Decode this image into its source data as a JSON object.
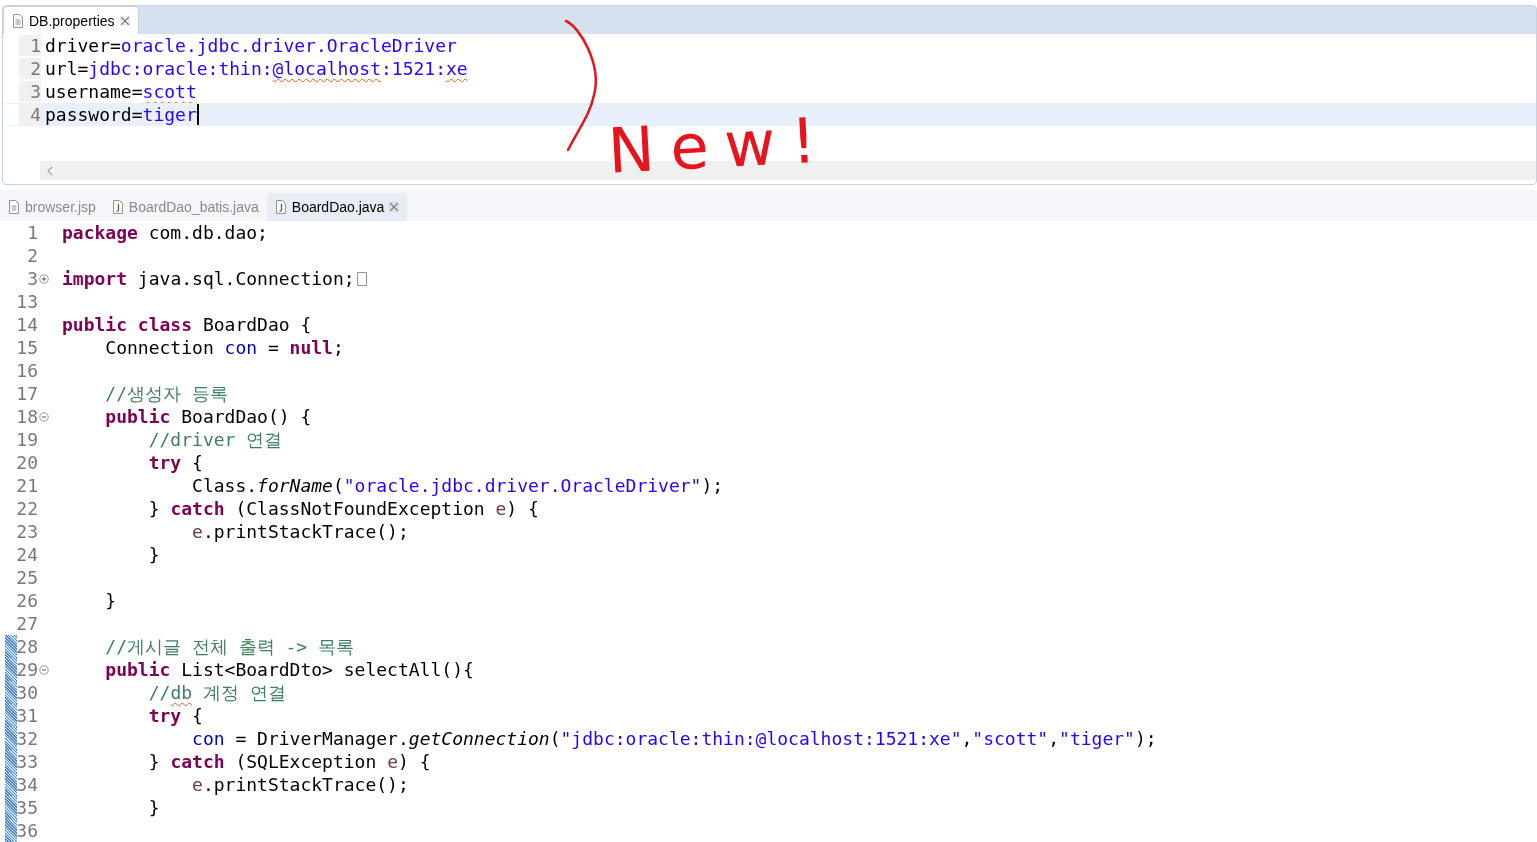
{
  "properties_editor": {
    "tabs": [
      {
        "label": "DB.properties",
        "kind": "text-file",
        "selected": true,
        "closable": true
      }
    ],
    "lines": [
      {
        "number": "1",
        "current": false,
        "caret": false,
        "tokens": [
          {
            "kind": "key",
            "text": "driver="
          },
          {
            "kind": "value",
            "text": "oracle.jdbc.driver.OracleDriver"
          }
        ]
      },
      {
        "number": "2",
        "current": false,
        "caret": false,
        "tokens": [
          {
            "kind": "key",
            "text": "url="
          },
          {
            "kind": "value",
            "text": "jdbc:oracle:thin:"
          },
          {
            "kind": "value",
            "text": "@localhost",
            "squiggle": true
          },
          {
            "kind": "value",
            "text": ":1521:"
          },
          {
            "kind": "value",
            "text": "xe",
            "squiggle": true
          }
        ]
      },
      {
        "number": "3",
        "current": false,
        "caret": false,
        "tokens": [
          {
            "kind": "key",
            "text": "username="
          },
          {
            "kind": "value",
            "text": "scott",
            "squiggle": true
          }
        ]
      },
      {
        "number": "4",
        "current": true,
        "caret": true,
        "tokens": [
          {
            "kind": "key",
            "text": "password="
          },
          {
            "kind": "value",
            "text": "tiger"
          }
        ]
      }
    ]
  },
  "java_editor": {
    "tabs": [
      {
        "label": "browser.jsp",
        "kind": "text-file",
        "selected": false,
        "closable": false
      },
      {
        "label": "BoardDao_batis.java",
        "kind": "java-file",
        "selected": false,
        "closable": false
      },
      {
        "label": "BoardDao.java",
        "kind": "java-file",
        "selected": true,
        "closable": true
      }
    ],
    "lines": [
      {
        "number": "1",
        "kind": "line",
        "changed": false,
        "tokens": [
          {
            "kind": "keyword",
            "text": "package"
          },
          {
            "kind": "plain",
            "text": " com.db.dao;"
          }
        ]
      },
      {
        "number": "2",
        "kind": "line",
        "changed": false
      },
      {
        "number": "3",
        "kind": "fold-start",
        "folded": true,
        "changed": false,
        "tokens": [
          {
            "kind": "keyword",
            "text": "import"
          },
          {
            "kind": "plain",
            "text": " java.sql.Connection;"
          }
        ]
      },
      {
        "number": "13",
        "kind": "line",
        "changed": false
      },
      {
        "number": "14",
        "kind": "line",
        "changed": false,
        "tokens": [
          {
            "kind": "keyword",
            "text": "public class"
          },
          {
            "kind": "plain",
            "text": " BoardDao {"
          }
        ]
      },
      {
        "number": "15",
        "kind": "line",
        "changed": false,
        "tokens": [
          {
            "kind": "plain",
            "text": "    Connection "
          },
          {
            "kind": "field",
            "text": "con"
          },
          {
            "kind": "plain",
            "text": " = "
          },
          {
            "kind": "keyword",
            "text": "null"
          },
          {
            "kind": "plain",
            "text": ";"
          }
        ]
      },
      {
        "number": "16",
        "kind": "line",
        "changed": false
      },
      {
        "number": "17",
        "kind": "line",
        "changed": false,
        "tokens": [
          {
            "kind": "comment",
            "text": "    //생성자 등록"
          }
        ]
      },
      {
        "number": "18",
        "kind": "fold-start",
        "folded": false,
        "changed": false,
        "tokens": [
          {
            "kind": "keyword",
            "text": "    public"
          },
          {
            "kind": "plain",
            "text": " BoardDao() {"
          }
        ]
      },
      {
        "number": "19",
        "kind": "line",
        "changed": false,
        "tokens": [
          {
            "kind": "comment",
            "text": "        //driver 연결"
          }
        ]
      },
      {
        "number": "20",
        "kind": "line",
        "changed": false,
        "tokens": [
          {
            "kind": "keyword",
            "text": "        try"
          },
          {
            "kind": "plain",
            "text": " {"
          }
        ]
      },
      {
        "number": "21",
        "kind": "line",
        "changed": false,
        "tokens": [
          {
            "kind": "plain",
            "text": "            Class."
          },
          {
            "kind": "static-method",
            "text": "forName"
          },
          {
            "kind": "plain",
            "text": "("
          },
          {
            "kind": "string",
            "text": "\"oracle.jdbc.driver.OracleDriver\""
          },
          {
            "kind": "plain",
            "text": ");"
          }
        ]
      },
      {
        "number": "22",
        "kind": "line",
        "changed": false,
        "tokens": [
          {
            "kind": "plain",
            "text": "        } "
          },
          {
            "kind": "keyword",
            "text": "catch"
          },
          {
            "kind": "plain",
            "text": " (ClassNotFoundException "
          },
          {
            "kind": "local",
            "text": "e"
          },
          {
            "kind": "plain",
            "text": ") {"
          }
        ]
      },
      {
        "number": "23",
        "kind": "line",
        "changed": false,
        "tokens": [
          {
            "kind": "local",
            "text": "            e"
          },
          {
            "kind": "plain",
            "text": ".printStackTrace();"
          }
        ]
      },
      {
        "number": "24",
        "kind": "line",
        "changed": false,
        "tokens": [
          {
            "kind": "plain",
            "text": "        }"
          }
        ]
      },
      {
        "number": "25",
        "kind": "line",
        "changed": false
      },
      {
        "number": "26",
        "kind": "line",
        "changed": false,
        "tokens": [
          {
            "kind": "plain",
            "text": "    }"
          }
        ]
      },
      {
        "number": "27",
        "kind": "line",
        "changed": false
      },
      {
        "number": "28",
        "kind": "line",
        "changed": true,
        "tokens": [
          {
            "kind": "comment",
            "text": "    //게시글 전체 출력 -> 목록"
          }
        ]
      },
      {
        "number": "29",
        "kind": "fold-start",
        "folded": false,
        "changed": true,
        "tokens": [
          {
            "kind": "keyword",
            "text": "    public"
          },
          {
            "kind": "plain",
            "text": " List<BoardDto> selectAll(){"
          }
        ]
      },
      {
        "number": "30",
        "kind": "line",
        "changed": true,
        "tokens": [
          {
            "kind": "comment",
            "text": "        //"
          },
          {
            "kind": "comment",
            "text": "db",
            "squiggle": true
          },
          {
            "kind": "comment",
            "text": " 계정 연결"
          }
        ]
      },
      {
        "number": "31",
        "kind": "line",
        "changed": true,
        "tokens": [
          {
            "kind": "keyword",
            "text": "        try"
          },
          {
            "kind": "plain",
            "text": " {"
          }
        ]
      },
      {
        "number": "32",
        "kind": "line",
        "changed": true,
        "tokens": [
          {
            "kind": "field",
            "text": "            con"
          },
          {
            "kind": "plain",
            "text": " = DriverManager."
          },
          {
            "kind": "static-method",
            "text": "getConnection"
          },
          {
            "kind": "plain",
            "text": "("
          },
          {
            "kind": "string",
            "text": "\"jdbc:oracle:thin:@localhost:1521:xe\""
          },
          {
            "kind": "plain",
            "text": ","
          },
          {
            "kind": "string",
            "text": "\"scott\""
          },
          {
            "kind": "plain",
            "text": ","
          },
          {
            "kind": "string",
            "text": "\"tiger\""
          },
          {
            "kind": "plain",
            "text": ");"
          }
        ]
      },
      {
        "number": "33",
        "kind": "line",
        "changed": true,
        "tokens": [
          {
            "kind": "plain",
            "text": "        } "
          },
          {
            "kind": "keyword",
            "text": "catch"
          },
          {
            "kind": "plain",
            "text": " (SQLException "
          },
          {
            "kind": "local",
            "text": "e"
          },
          {
            "kind": "plain",
            "text": ") {"
          }
        ]
      },
      {
        "number": "34",
        "kind": "line",
        "changed": true,
        "tokens": [
          {
            "kind": "local",
            "text": "            e"
          },
          {
            "kind": "plain",
            "text": ".printStackTrace();"
          }
        ]
      },
      {
        "number": "35",
        "kind": "line",
        "changed": true,
        "tokens": [
          {
            "kind": "plain",
            "text": "        }"
          }
        ]
      },
      {
        "number": "36",
        "kind": "line",
        "changed": true
      }
    ]
  },
  "annotation": {
    "text": "New!",
    "color": "#e8141b"
  }
}
